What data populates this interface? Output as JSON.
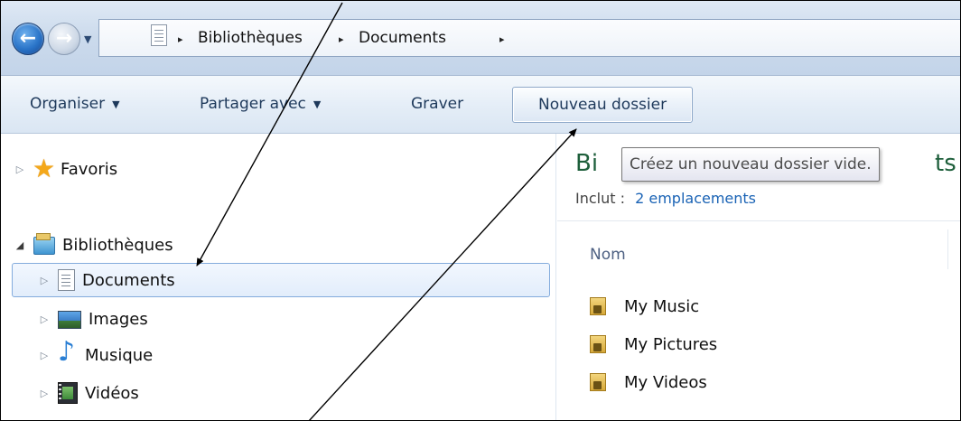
{
  "address": {
    "crumbs": [
      "Bibliothèques",
      "Documents"
    ],
    "separator": "▸"
  },
  "toolbar": {
    "organize_label": "Organiser",
    "share_label": "Partager avec",
    "burn_label": "Graver",
    "new_folder_label": "Nouveau dossier",
    "caret": "▼"
  },
  "tooltip": {
    "text": "Créez un nouveau dossier vide."
  },
  "navpane": {
    "favorites": "Favoris",
    "libraries": "Bibliothèques",
    "items": [
      {
        "label": "Documents",
        "icon": "document-icon",
        "selected": true
      },
      {
        "label": "Images",
        "icon": "picture-icon"
      },
      {
        "label": "Musique",
        "icon": "music-icon"
      },
      {
        "label": "Vidéos",
        "icon": "video-icon"
      }
    ]
  },
  "content": {
    "title_start": "Bi",
    "title_end": "ts",
    "includes_label": "Inclut :",
    "includes_link": "2 emplacements",
    "column_name": "Nom",
    "files": [
      "My Music",
      "My Pictures",
      "My Videos"
    ]
  },
  "colors": {
    "toolbar_text": "#1e395b",
    "title_green": "#1e5f3b",
    "link_blue": "#1a63b5",
    "selection_border": "#84acdd"
  }
}
